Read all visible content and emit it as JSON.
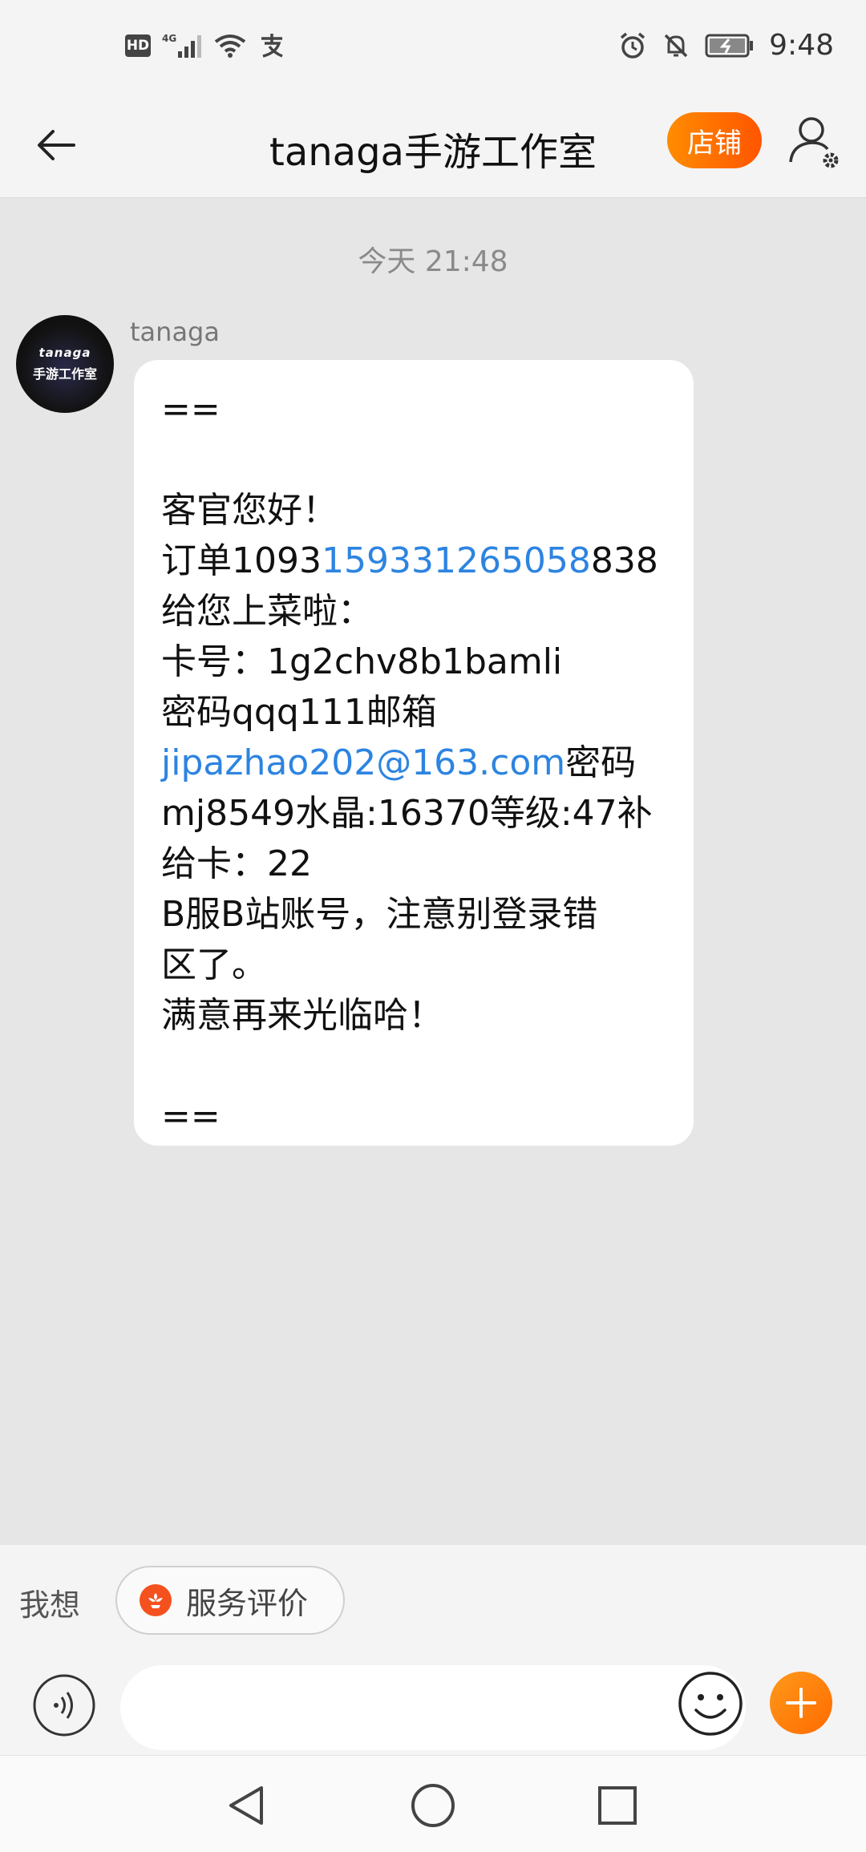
{
  "status_bar": {
    "hd_badge": "HD",
    "network": "4G",
    "time": "9:48",
    "icons": [
      "hd-icon",
      "signal-icon",
      "wifi-icon",
      "alipay-icon",
      "alarm-icon",
      "mute-icon",
      "battery-icon"
    ]
  },
  "header": {
    "title": "tanaga手游工作室",
    "shop_label": "店铺"
  },
  "chat": {
    "timestamp": "今天  21:48",
    "sender_name": "tanaga",
    "avatar": {
      "line1": "tanaga",
      "line2": "手游工作室"
    },
    "message": {
      "separator_top": "==",
      "greeting": "客官您好！",
      "order_prefix": "订单1093",
      "order_link": "159331265058",
      "order_suffix": "838",
      "served": "给您上菜啦：",
      "card": "卡号：1g2chv8b1bamli",
      "password": "密码qqq111邮箱",
      "email_link": "jipazhao202@163.com",
      "email_suffix": "密码",
      "details": "mj8549水晶:16370等级:47补",
      "extra_card": "给卡：22",
      "note_line1": "B服B站账号，注意别登录错",
      "note_line2": "区了。",
      "closing": "满意再来光临哈！",
      "separator_bottom": "=="
    }
  },
  "quick_replies": {
    "label": "我想",
    "chip_label": "服务评价"
  },
  "input": {
    "value": "",
    "placeholder": ""
  },
  "colors": {
    "accent": "#ff6a00",
    "link": "#2d84e0",
    "chat_bg": "#e6e6e6"
  }
}
